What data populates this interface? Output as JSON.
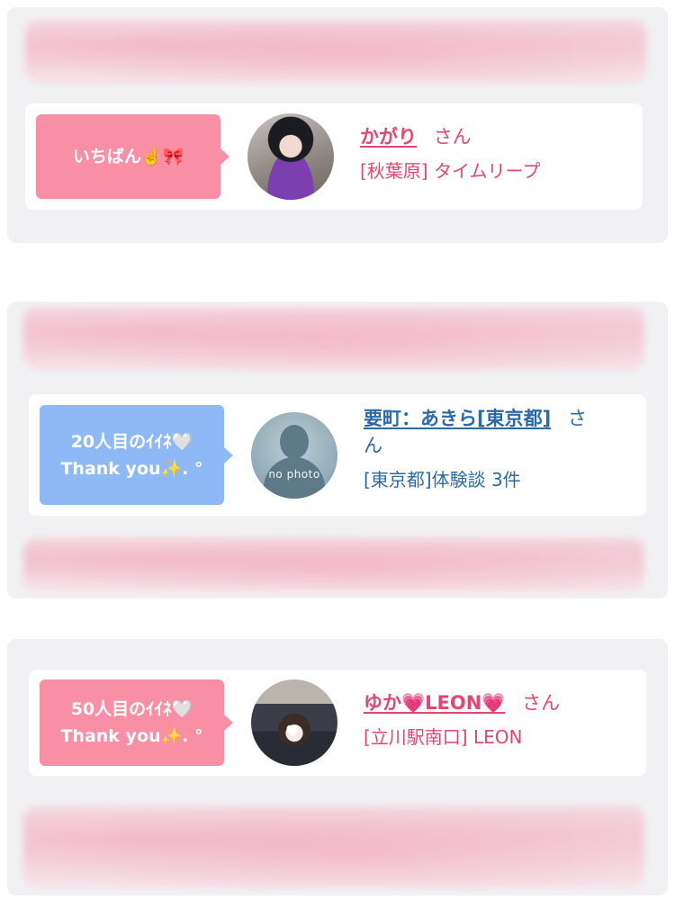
{
  "entries": [
    {
      "badge_lines": [
        "いちばん☝️🎀"
      ],
      "avatar_text": "",
      "name": "かがり",
      "suffix": "さん",
      "detail": "[秋葉原] タイムリープ"
    },
    {
      "badge_lines": [
        "20人目のｲｲﾈ🤍",
        "Thank you✨. °"
      ],
      "avatar_text": "no photo",
      "name": "要町：あきら[東京都]",
      "suffix": "さ\nん",
      "detail": "[東京都]体験談 3件"
    },
    {
      "badge_lines": [
        "50人目のｲｲﾈ🤍",
        "Thank you✨. °"
      ],
      "avatar_text": "",
      "name": "ゆか💗LEON💗",
      "suffix": "さん",
      "detail": "[立川駅南口] LEON"
    }
  ],
  "colors": {
    "pink_badge": "#f98fa4",
    "blue_badge": "#8fb9f6",
    "pink_text": "#e2486f",
    "blue_text": "#2c6aa6",
    "panel_bg": "#f1f1f3"
  },
  "icons": {
    "avatar_1": "profile-photo",
    "avatar_2": "no-photo-silhouette",
    "avatar_3": "profile-photo"
  }
}
